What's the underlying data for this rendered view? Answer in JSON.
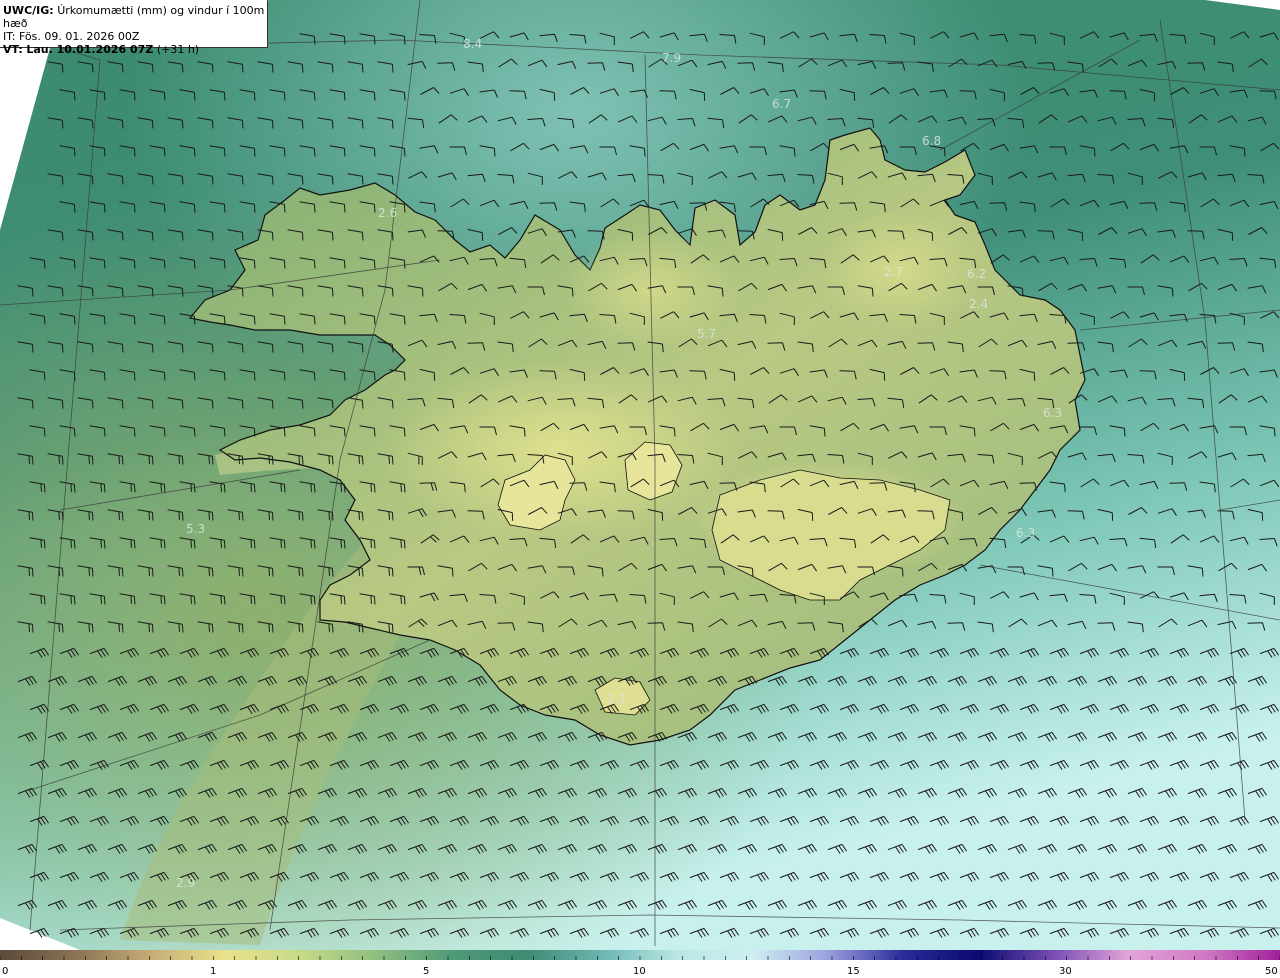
{
  "header": {
    "model": "UWC/IG:",
    "title": "Úrkomumætti (mm) og vindur í 100m hæð",
    "it_label": "IT:",
    "it_value": "Fös. 09. 01. 2026 00Z",
    "vt_label": "VT:",
    "vt_value": "Lau. 10.01.2026 07Z",
    "vt_offset": "(+31 h)"
  },
  "map_labels": [
    "8.4",
    "7.9",
    "6.7",
    "6.8",
    "2.6",
    "2.7",
    "6.2",
    "2.4",
    "5.7",
    "6.3",
    "5.3",
    "6.3",
    "2.1",
    "2.9"
  ],
  "colorbar": {
    "ticks": [
      "0",
      "1",
      "5",
      "10",
      "15",
      "30",
      "50"
    ],
    "tick_values": [
      0,
      1,
      5,
      10,
      15,
      30,
      50
    ],
    "colors": [
      "#5a4a3a",
      "#8a7355",
      "#c4ad75",
      "#e9e28a",
      "#c6d987",
      "#8fbf80",
      "#4f9a78",
      "#3f8a74",
      "#6bb7b1",
      "#b9e6e6",
      "#cfeff3",
      "#9aa0dc",
      "#2a2a9a",
      "#0a0a70",
      "#7a4fb5",
      "#e2a5d8",
      "#d07ac5",
      "#a0209a"
    ]
  },
  "colors": {
    "sea_deep": "#2f7a68",
    "sea_light": "#bfeeea",
    "land_low": "#4f9a70",
    "land_high": "#d4d98a",
    "coast": "#111111",
    "barb": "#1a1a1a"
  }
}
